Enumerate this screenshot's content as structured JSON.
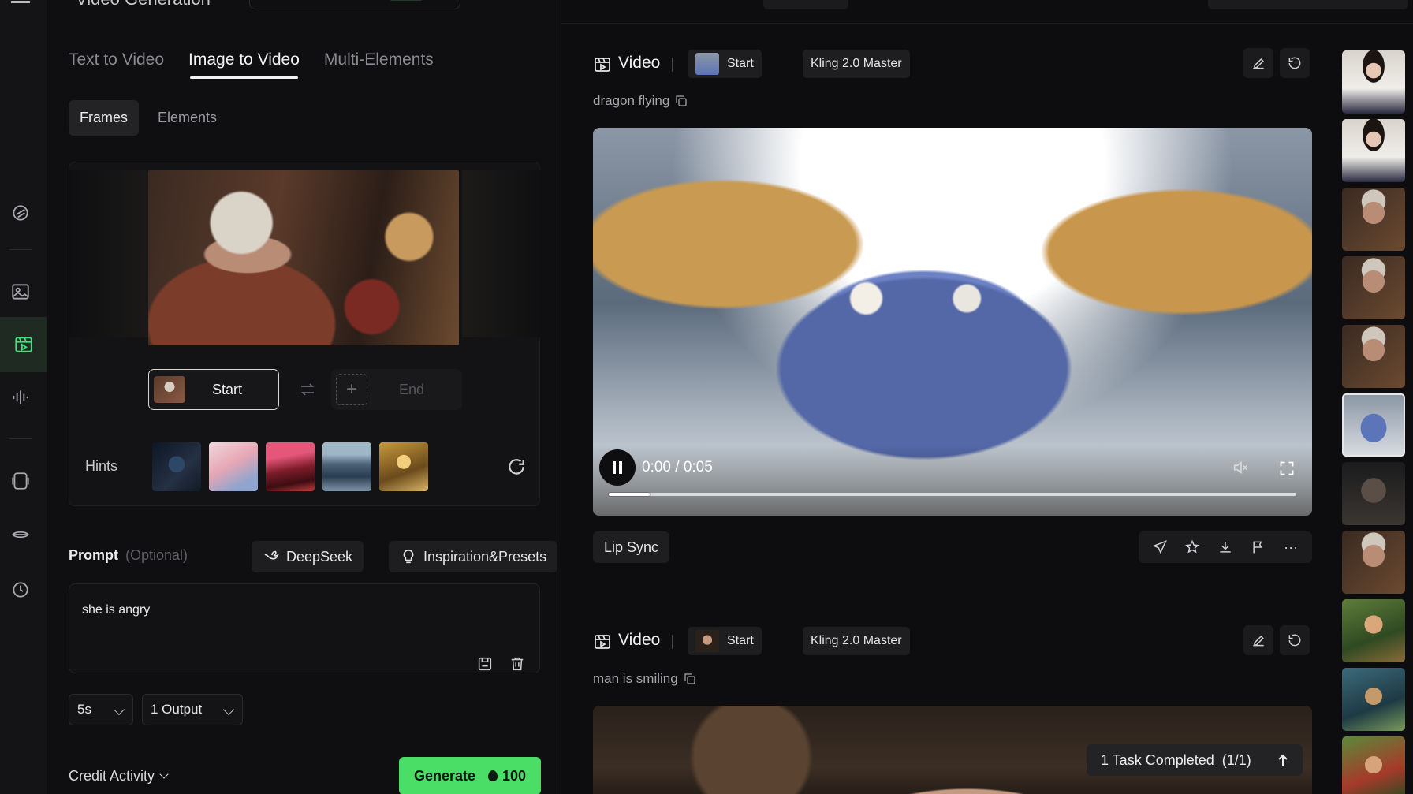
{
  "header": {
    "title": "Video Generation"
  },
  "tabs": [
    {
      "label": "Text to Video",
      "active": false
    },
    {
      "label": "Image to Video",
      "active": true
    },
    {
      "label": "Multi-Elements",
      "active": false
    }
  ],
  "subtabs": [
    {
      "label": "Frames",
      "active": true
    },
    {
      "label": "Elements",
      "active": false
    }
  ],
  "frames": {
    "start_label": "Start",
    "end_label": "End",
    "hints_label": "Hints"
  },
  "prompt": {
    "title": "Prompt",
    "optional": "(Optional)",
    "deepseek_label": "DeepSeek",
    "inspiration_label": "Inspiration&Presets",
    "value": "she is angry"
  },
  "settings": {
    "duration": "5s",
    "outputs": "1 Output"
  },
  "footer": {
    "credit_label": "Credit Activity",
    "generate_label": "Generate",
    "generate_cost": "100"
  },
  "feed": [
    {
      "type_label": "Video",
      "start_label": "Start",
      "model": "Kling 2.0 Master",
      "prompt": "dragon flying",
      "time": "0:00 / 0:05",
      "progress": 0.06,
      "lip_sync_label": "Lip Sync"
    },
    {
      "type_label": "Video",
      "start_label": "Start",
      "model": "Kling 2.0 Master",
      "prompt": "man is smiling"
    }
  ],
  "toast": {
    "text": "1 Task Completed",
    "count": "(1/1)"
  },
  "thumbnails": [
    "girl",
    "girl",
    "old-woman",
    "old-woman",
    "old-woman",
    "dragon",
    "goblin",
    "old-woman",
    "anime-boy",
    "anime-warrior",
    "anime-boy"
  ],
  "selected_thumbnail": 5,
  "colors": {
    "accent": "#4ade66",
    "active_rail": "#42e07a",
    "background": "#0d0d0f"
  }
}
